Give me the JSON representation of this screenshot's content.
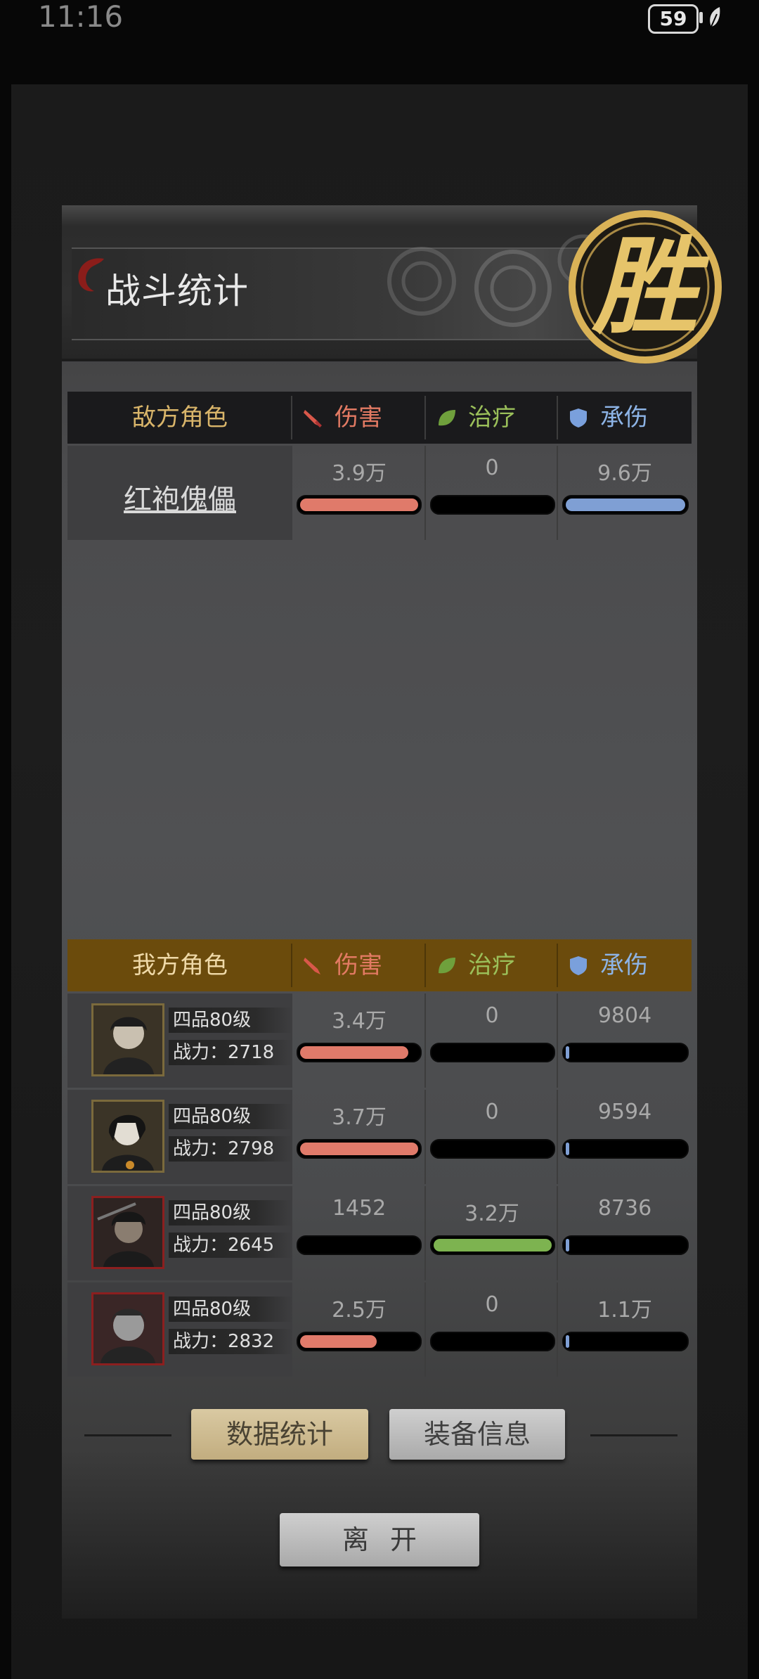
{
  "status": {
    "time": "11:16",
    "battery": "59"
  },
  "title": "战斗统计",
  "seal": "胜",
  "columns": {
    "damage": "伤害",
    "healing": "治疗",
    "tanked": "承伤"
  },
  "enemy": {
    "header": "敌方角色",
    "rows": [
      {
        "name": "红袍傀儡",
        "damage": "3.9万",
        "damage_ratio": 1.0,
        "healing": "0",
        "healing_ratio": 0,
        "tanked": "9.6万",
        "tanked_ratio": 1.0
      }
    ]
  },
  "ally": {
    "header": "我方角色",
    "rows": [
      {
        "rank": "四品80级",
        "power": "战力：2718",
        "damage": "3.4万",
        "damage_ratio": 0.92,
        "healing": "0",
        "healing_ratio": 0,
        "tanked": "9804",
        "tanked_ratio": 0.02
      },
      {
        "rank": "四品80级",
        "power": "战力：2798",
        "damage": "3.7万",
        "damage_ratio": 1.0,
        "healing": "0",
        "healing_ratio": 0,
        "tanked": "9594",
        "tanked_ratio": 0.02
      },
      {
        "rank": "四品80级",
        "power": "战力：2645",
        "damage": "1452",
        "damage_ratio": 0.0,
        "healing": "3.2万",
        "healing_ratio": 1.0,
        "tanked": "8736",
        "tanked_ratio": 0.02
      },
      {
        "rank": "四品80级",
        "power": "战力：2832",
        "damage": "2.5万",
        "damage_ratio": 0.66,
        "healing": "0",
        "healing_ratio": 0,
        "tanked": "1.1万",
        "tanked_ratio": 0.02
      }
    ]
  },
  "buttons": {
    "stats": "数据统计",
    "equip": "装备信息",
    "leave": "离开"
  },
  "colors": {
    "damage": "#e07a6a",
    "healing": "#7db350",
    "tanked": "#7f9fd4"
  }
}
